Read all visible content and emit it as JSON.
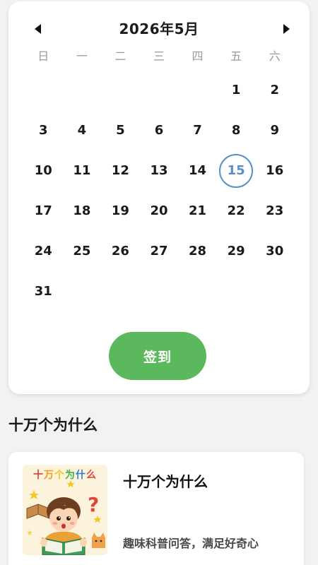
{
  "calendar": {
    "title": "2026年5月",
    "weekdays": [
      "日",
      "一",
      "二",
      "三",
      "四",
      "五",
      "六"
    ],
    "leading_blanks": 5,
    "days": [
      "1",
      "2",
      "3",
      "4",
      "5",
      "6",
      "7",
      "8",
      "9",
      "10",
      "11",
      "12",
      "13",
      "14",
      "15",
      "16",
      "17",
      "18",
      "19",
      "20",
      "21",
      "22",
      "23",
      "24",
      "25",
      "26",
      "27",
      "28",
      "29",
      "30",
      "31"
    ],
    "today": "15",
    "today_color": "#5b8fc7"
  },
  "checkin": {
    "label": "签到",
    "color": "#5cb85c"
  },
  "section": {
    "title": "十万个为什么"
  },
  "book": {
    "cover_title": [
      "十",
      "万",
      "个",
      "为",
      "什",
      "么"
    ],
    "title": "十万个为什么",
    "description": "趣味科普问答，满足好奇心"
  }
}
